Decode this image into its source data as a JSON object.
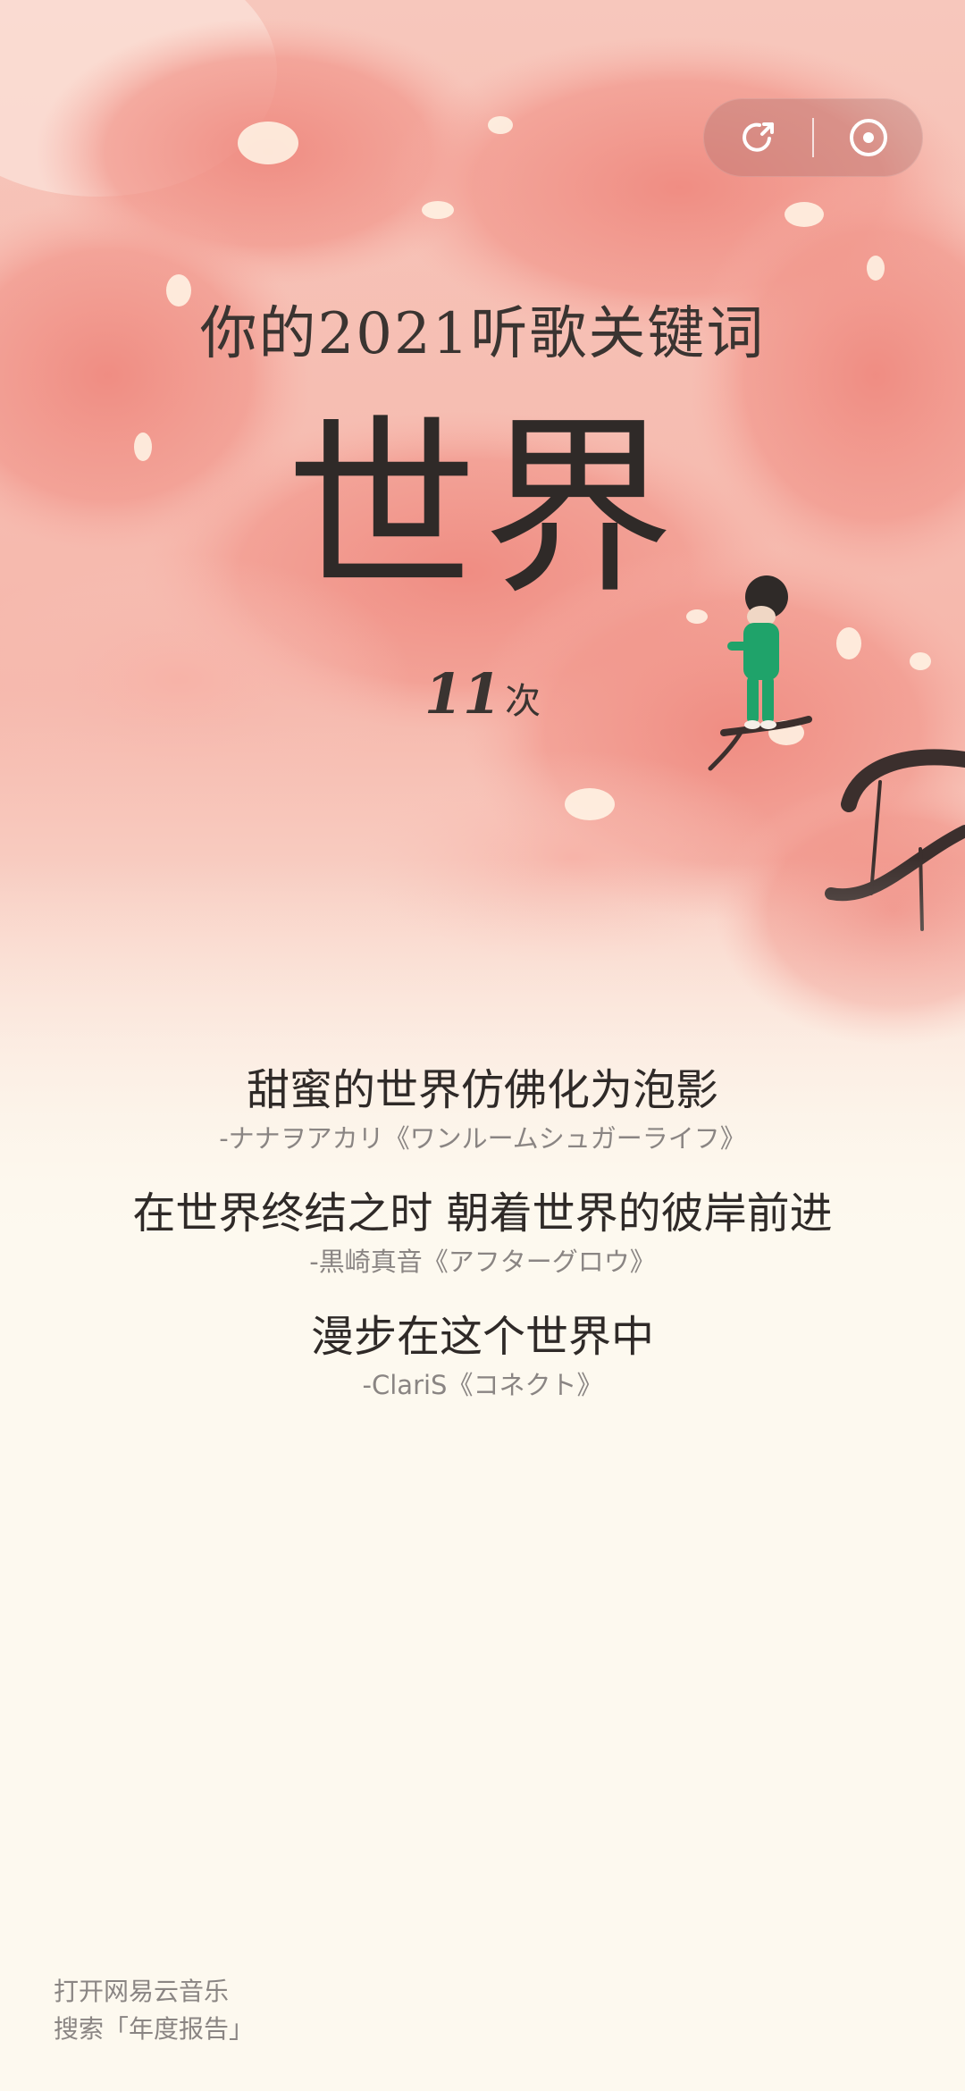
{
  "toolbar": {
    "share_icon": "share-icon",
    "close_icon": "record-close-icon"
  },
  "report": {
    "title": "你的2021听歌关键词",
    "keyword": "世界",
    "count": "11",
    "count_unit": "次"
  },
  "lyrics": [
    {
      "line": "甜蜜的世界仿佛化为泡影",
      "source": "-ナナヲアカリ《ワンルームシュガーライフ》"
    },
    {
      "line": "在世界终结之时 朝着世界的彼岸前进",
      "source": "-黒崎真音《アフターグロウ》"
    },
    {
      "line": "漫步在这个世界中",
      "source": "-ClariS《コネクト》"
    }
  ],
  "footer": {
    "line1": "打开网易云音乐",
    "line2": "搜索「年度报告」"
  },
  "colors": {
    "background": "#fdf9ef",
    "blossom": "#f08c82",
    "text_dark": "#2f2a28",
    "text_muted": "#8a8583",
    "figure_green": "#1fa36a"
  }
}
